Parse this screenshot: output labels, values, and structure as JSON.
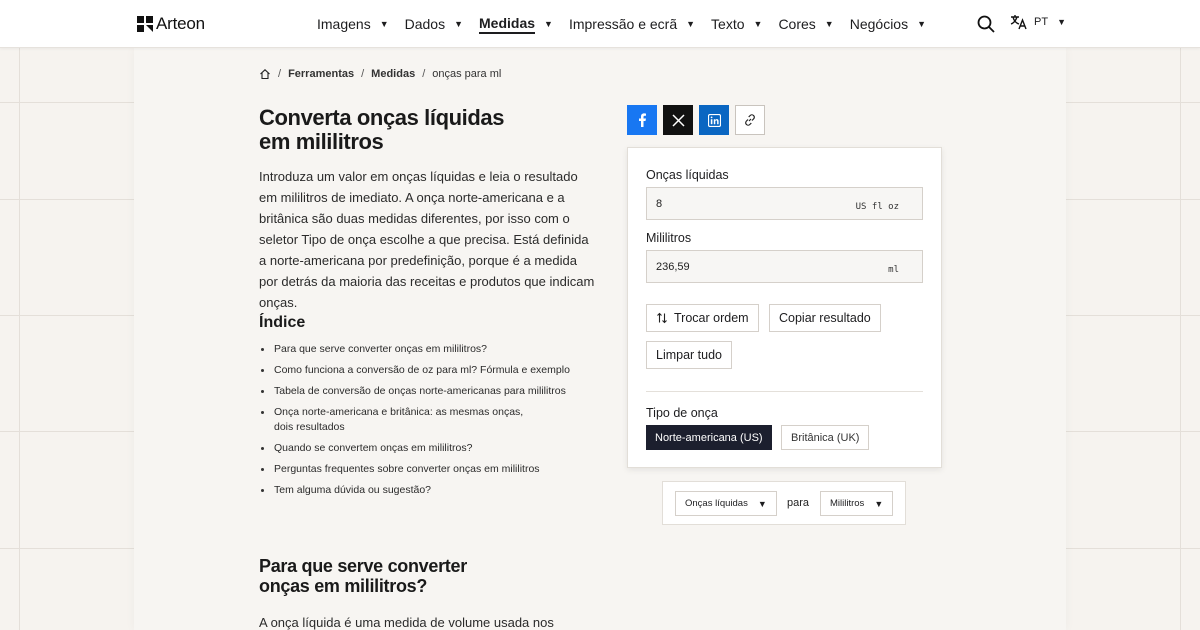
{
  "brand": {
    "name": "Arteon"
  },
  "nav": {
    "items": [
      {
        "label": "Imagens",
        "active": false
      },
      {
        "label": "Dados",
        "active": false
      },
      {
        "label": "Medidas",
        "active": true
      },
      {
        "label": "Impressão e ecrã",
        "active": false
      },
      {
        "label": "Texto",
        "active": false
      },
      {
        "label": "Cores",
        "active": false
      },
      {
        "label": "Negócios",
        "active": false
      }
    ],
    "language": "PT"
  },
  "breadcrumb": {
    "items": [
      "Ferramentas",
      "Medidas"
    ],
    "current": "onças para ml"
  },
  "page": {
    "title": "Converta onças líquidas em mililitros",
    "intro": "Introduza um valor em onças líquidas e leia o resultado em mililitros de imediato. A onça norte-americana e a britânica são duas medidas diferentes, por isso com o seletor Tipo de onça escolhe a que precisa. Está definida a norte-americana por predefinição, porque é a medida por detrás da maioria das receitas e produtos que indicam onças."
  },
  "toc": {
    "title": "Índice",
    "items": [
      "Para que serve converter onças em mililitros?",
      "Como funciona a conversão de oz para ml? Fórmula e exemplo",
      "Tabela de conversão de onças norte-americanas para mililitros",
      "Onça norte-americana e britânica: as mesmas onças, dois resultados",
      "Quando se convertem onças em mililitros?",
      "Perguntas frequentes sobre converter onças em mililitros",
      "Tem alguma dúvida ou sugestão?"
    ]
  },
  "section": {
    "title": "Para que serve converter onças em mililitros?",
    "text": "A onça líquida é uma medida de volume usada nos Estados"
  },
  "converter": {
    "from_label": "Onças líquidas",
    "from_value": "8",
    "from_unit": "US fl oz",
    "to_label": "Mililitros",
    "to_value": "236,59",
    "to_unit": "ml",
    "swap_label": "Trocar ordem",
    "copy_label": "Copiar resultado",
    "clear_label": "Limpar tudo",
    "type_label": "Tipo de onça",
    "type_options": [
      "Norte-americana (US)",
      "Britânica (UK)"
    ],
    "type_selected": "Norte-americana (US)"
  },
  "unit_selector": {
    "from": "Onças líquidas",
    "connector": "para",
    "to": "Mililitros"
  },
  "colors": {
    "facebook": "#1877f2",
    "x": "#111111",
    "linkedin": "#0a66c2",
    "selected_segment": "#1c1f2e"
  }
}
